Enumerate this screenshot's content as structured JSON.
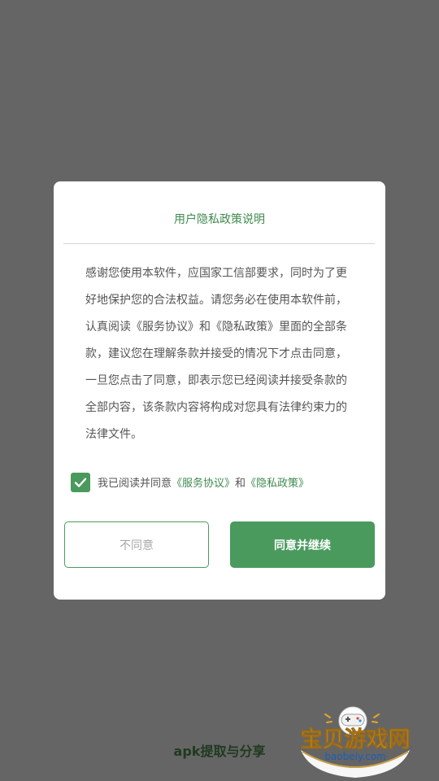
{
  "dialog": {
    "title": "用户隐私政策说明",
    "body_lines": [
      "感谢您使用本软件，应国家工信部要求，同时为了更",
      "好地保护您的合法权益。请您务必在使用本软件前，",
      "认真阅读《服务协议》和《隐私政策》里面的全部条",
      "款，建议您在理解条款并接受的情况下才点击同意，",
      "一旦您点击了同意，即表示您已经阅读并接受条款的",
      "全部内容，该条款内容将构成对您具有法律约束力的",
      "法律文件。"
    ],
    "consent": {
      "checked": true,
      "prefix": "我已阅读并同意",
      "service_link": "《服务协议》",
      "conjunction": "和",
      "privacy_link": "《隐私政策》"
    },
    "decline_label": "不同意",
    "accept_label": "同意并继续"
  },
  "footer": {
    "text": "apk提取与分享"
  },
  "watermark": {
    "title": "宝贝游戏网",
    "url": "baobeiy.com"
  },
  "colors": {
    "backdrop": "#656565",
    "accent": "#4a9a5d",
    "title_green": "#3f8a4f"
  }
}
